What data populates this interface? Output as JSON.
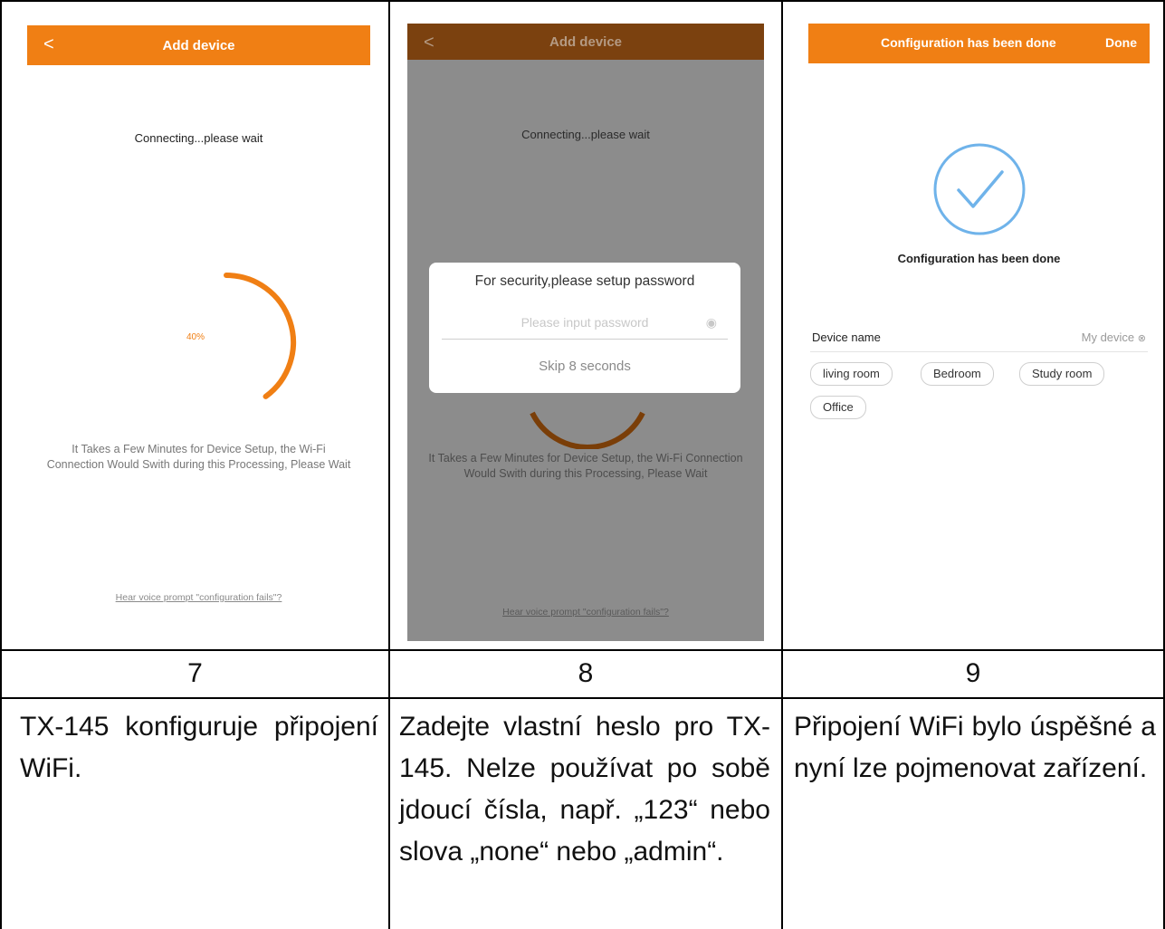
{
  "screens": {
    "s7": {
      "title": "Add device",
      "back": "<",
      "connecting": "Connecting...please wait",
      "progress_label": "40%",
      "progress": 0.4,
      "info": "It Takes a Few Minutes for Device Setup, the Wi-Fi Connection Would Swith during this Processing, Please Wait",
      "voice_link": "Hear voice prompt \"configuration fails\"?"
    },
    "s8": {
      "title": "Add device",
      "back": "<",
      "connecting": "Connecting...please wait",
      "dialog_title": "For security,please setup password",
      "password_placeholder": "Please input password",
      "skip": "Skip 8 seconds",
      "info": "It Takes a Few Minutes for Device Setup, the Wi-Fi Connection Would Swith during this Processing, Please Wait",
      "voice_link": "Hear voice prompt \"configuration fails\"?"
    },
    "s9": {
      "title": "Configuration has been done",
      "done_button": "Done",
      "status": "Configuration has been done",
      "device_name_label": "Device name",
      "device_name_value": "My device",
      "rooms": [
        "living room",
        "Bedroom",
        "Study room",
        "Office"
      ]
    }
  },
  "steps": {
    "s7": {
      "number": "7",
      "text": "TX-145 konfiguruje připojení WiFi."
    },
    "s8": {
      "number": "8",
      "text": "Zadejte vlastní heslo pro TX-145. Nelze používat po sobě jdoucí čísla, např. „123“ nebo slova „none“ nebo „admin“."
    },
    "s9": {
      "number": "9",
      "text": "Připojení WiFi bylo úspěšné a nyní lze pojmenovat zařízení."
    }
  },
  "colors": {
    "accent": "#f07f14",
    "check": "#6fb3ea"
  }
}
